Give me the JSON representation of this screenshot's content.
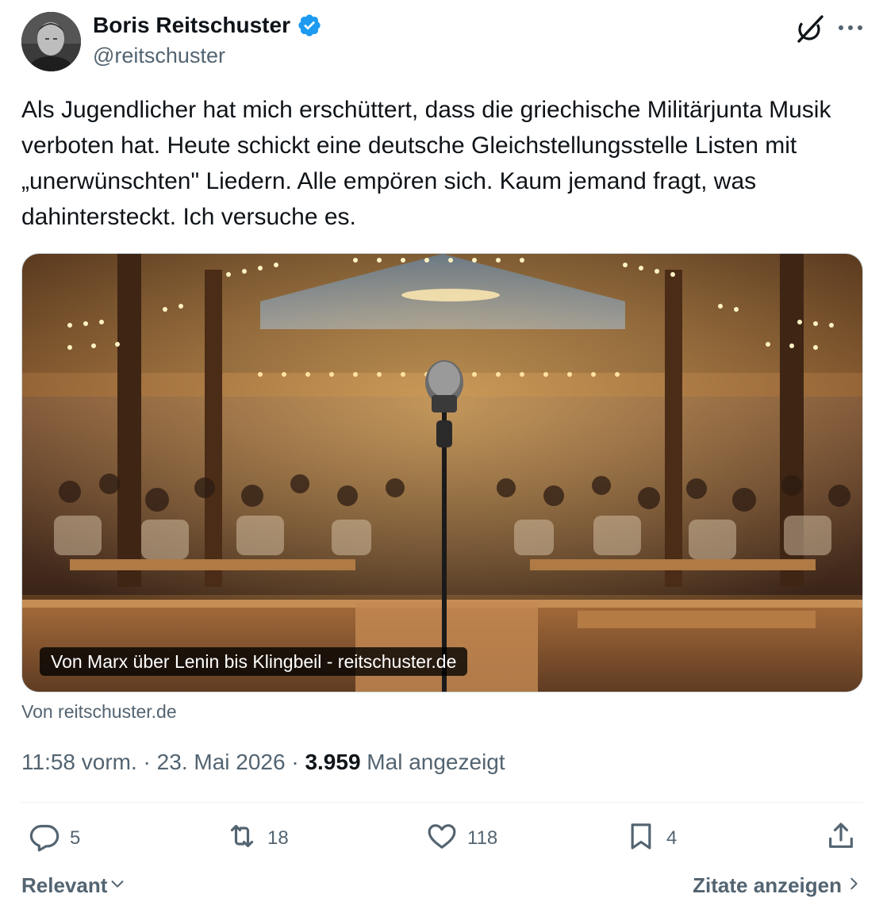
{
  "author": {
    "name": "Boris Reitschuster",
    "handle": "@reitschuster",
    "verified": true
  },
  "tweet": {
    "text": "Als Jugendlicher hat mich erschüttert, dass die griechische Militärjunta Musik verboten hat. Heute schickt eine deutsche Gleichstellungsstelle Listen mit „unerwünschten\" Liedern. Alle empören sich. Kaum jemand fragt, was dahintersteckt. Ich versuche es."
  },
  "card": {
    "caption": "Von Marx über Lenin bis Klingbeil - reitschuster.de",
    "source": "Von reitschuster.de"
  },
  "meta": {
    "time": "11:58 vorm.",
    "sep1": " · ",
    "date": "23. Mai 2026",
    "sep2": " · ",
    "views": "3.959",
    "views_label": " Mal angezeigt"
  },
  "actions": {
    "replies": "5",
    "reposts": "18",
    "likes": "118",
    "bookmarks": "4"
  },
  "footer": {
    "sort_label": "Relevant",
    "quotes_label": "Zitate anzeigen"
  },
  "colors": {
    "verified_blue": "#1d9bf0",
    "text_primary": "#0f1419",
    "text_secondary": "#536471",
    "divider": "#eff3f4"
  },
  "icons": {
    "verified": "verified-badge-icon",
    "grok": "grok-icon",
    "more": "more-icon",
    "reply": "reply-icon",
    "repost": "repost-icon",
    "like": "heart-icon",
    "bookmark": "bookmark-icon",
    "share": "share-icon",
    "sort": "chevron-down-icon",
    "quotes": "chevron-right-icon"
  }
}
